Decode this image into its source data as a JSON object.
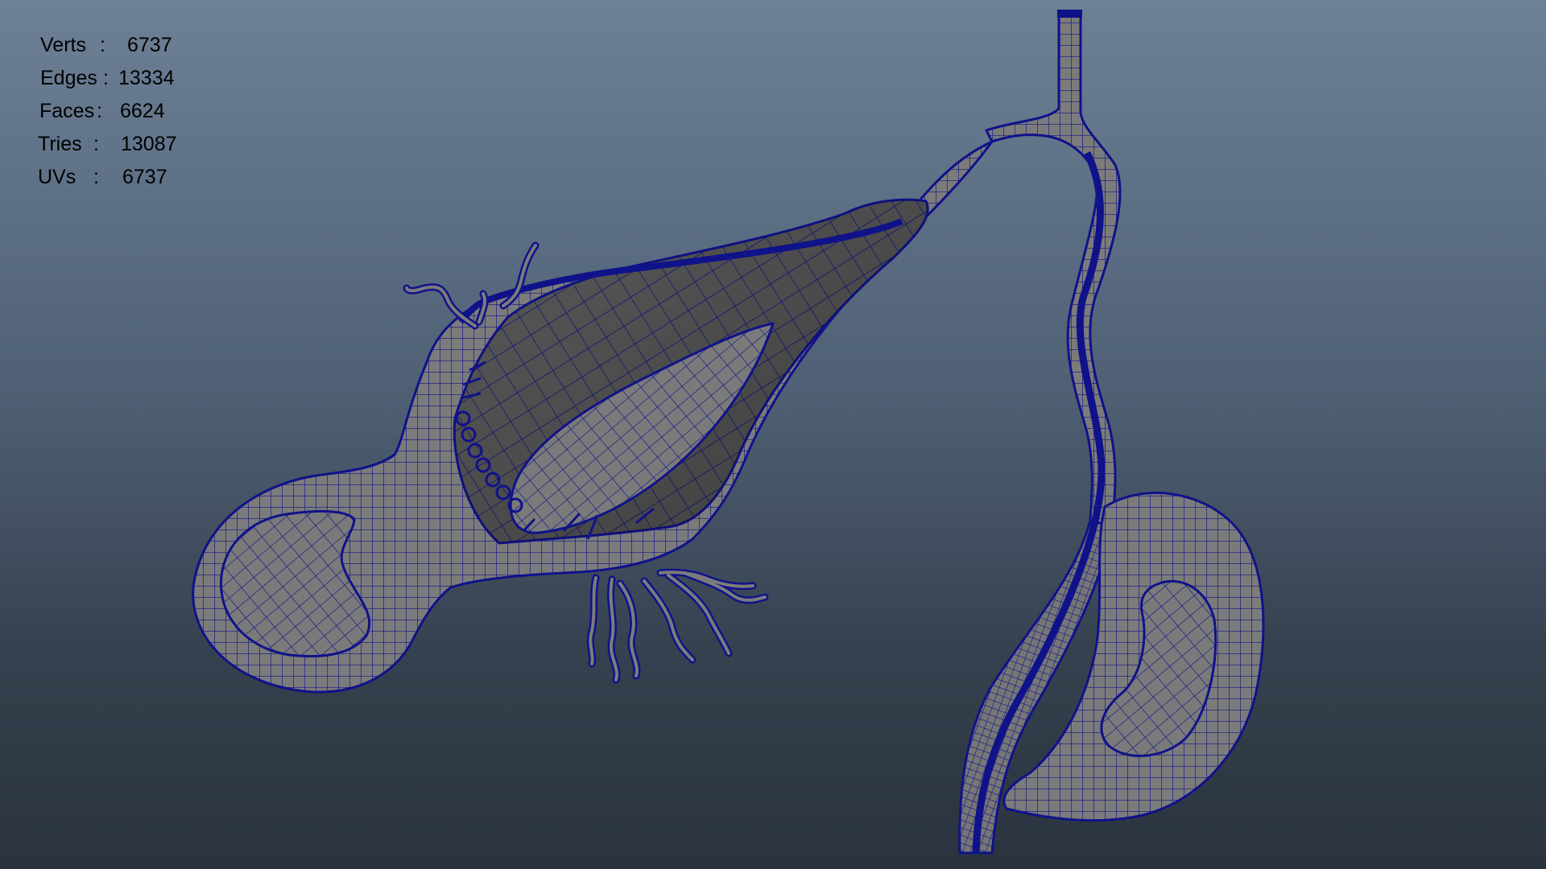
{
  "hud": {
    "rows": [
      {
        "label": "Verts",
        "sep": ":",
        "value": "6737"
      },
      {
        "label": "Edges",
        "sep": ":",
        "value": "13334"
      },
      {
        "label": "Faces",
        "sep": ":",
        "value": "6624"
      },
      {
        "label": "Tries",
        "sep": ":",
        "value": "13087"
      },
      {
        "label": "UVs",
        "sep": ":",
        "value": "6737"
      }
    ]
  },
  "colors": {
    "wire": "#10128a",
    "surface": "#7b7b7b",
    "surface_dark": "#5a5a5a",
    "cavity": "#5c5c5c",
    "background_top": "#6d8096",
    "background_bottom": "#2a333e"
  }
}
